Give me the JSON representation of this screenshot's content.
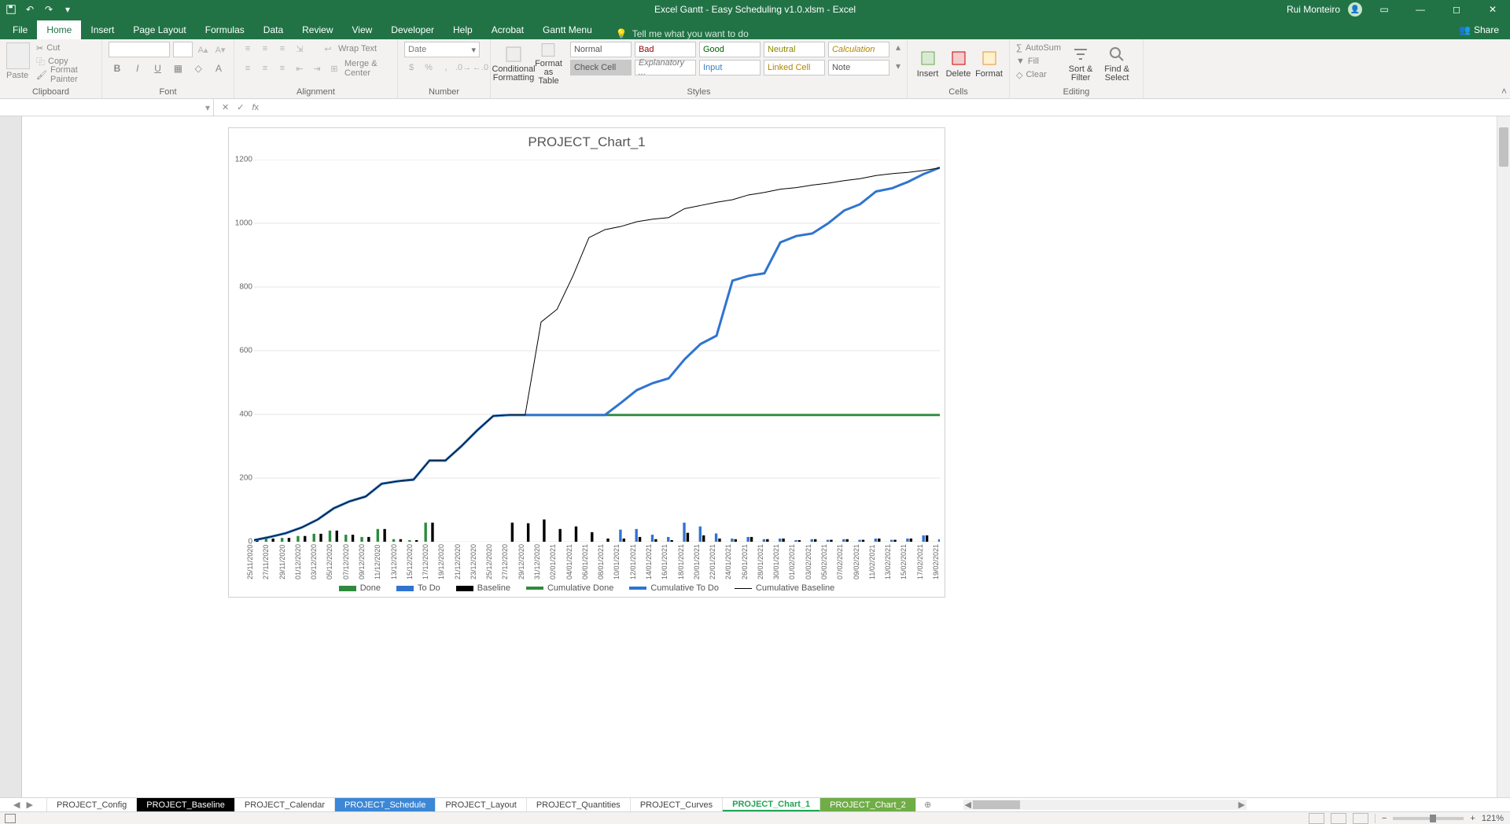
{
  "titlebar": {
    "app_title": "Excel Gantt - Easy Scheduling v1.0.xlsm - Excel",
    "user": "Rui Monteiro"
  },
  "ribbon_tabs": [
    "File",
    "Home",
    "Insert",
    "Page Layout",
    "Formulas",
    "Data",
    "Review",
    "View",
    "Developer",
    "Help",
    "Acrobat",
    "Gantt Menu"
  ],
  "tellme": "Tell me what you want to do",
  "share": "Share",
  "clipboard": {
    "paste": "Paste",
    "cut": "Cut",
    "copy": "Copy",
    "painter": "Format Painter",
    "label": "Clipboard"
  },
  "font": {
    "label": "Font"
  },
  "alignment": {
    "wrap": "Wrap Text",
    "merge": "Merge & Center",
    "label": "Alignment"
  },
  "number": {
    "format": "Date",
    "label": "Number"
  },
  "styles": {
    "cond": "Conditional Formatting",
    "table": "Format as Table",
    "normal": "Normal",
    "bad": "Bad",
    "good": "Good",
    "neutral": "Neutral",
    "calc": "Calculation",
    "check": "Check Cell",
    "explan": "Explanatory ...",
    "input": "Input",
    "linked": "Linked Cell",
    "note": "Note",
    "label": "Styles"
  },
  "cells": {
    "insert": "Insert",
    "delete": "Delete",
    "format": "Format",
    "label": "Cells"
  },
  "editing": {
    "autosum": "AutoSum",
    "fill": "Fill",
    "clear": "Clear",
    "sort": "Sort & Filter",
    "find": "Find & Select",
    "label": "Editing"
  },
  "sheet_tabs": [
    {
      "name": "PROJECT_Config",
      "style": "plain"
    },
    {
      "name": "PROJECT_Baseline",
      "style": "dark"
    },
    {
      "name": "PROJECT_Calendar",
      "style": "plain"
    },
    {
      "name": "PROJECT_Schedule",
      "style": "blue"
    },
    {
      "name": "PROJECT_Layout",
      "style": "plain"
    },
    {
      "name": "PROJECT_Quantities",
      "style": "plain"
    },
    {
      "name": "PROJECT_Curves",
      "style": "plain"
    },
    {
      "name": "PROJECT_Chart_1",
      "style": "active"
    },
    {
      "name": "PROJECT_Chart_2",
      "style": "green"
    }
  ],
  "status": {
    "zoom": "121%"
  },
  "chart_data": {
    "type": "combo",
    "title": "PROJECT_Chart_1",
    "ylim": [
      0,
      1200
    ],
    "yticks": [
      0,
      200,
      400,
      600,
      800,
      1000,
      1200
    ],
    "categories": [
      "25/11/2020",
      "27/11/2020",
      "29/11/2020",
      "01/12/2020",
      "03/12/2020",
      "05/12/2020",
      "07/12/2020",
      "09/12/2020",
      "11/12/2020",
      "13/12/2020",
      "15/12/2020",
      "17/12/2020",
      "19/12/2020",
      "21/12/2020",
      "23/12/2020",
      "25/12/2020",
      "27/12/2020",
      "29/12/2020",
      "31/12/2020",
      "02/01/2021",
      "04/01/2021",
      "06/01/2021",
      "08/01/2021",
      "10/01/2021",
      "12/01/2021",
      "14/01/2021",
      "16/01/2021",
      "18/01/2021",
      "20/01/2021",
      "22/01/2021",
      "24/01/2021",
      "26/01/2021",
      "28/01/2021",
      "30/01/2021",
      "01/02/2021",
      "03/02/2021",
      "05/02/2021",
      "07/02/2021",
      "09/02/2021",
      "11/02/2021",
      "13/02/2021",
      "15/02/2021",
      "17/02/2021",
      "19/02/2021"
    ],
    "series": [
      {
        "name": "Done",
        "type": "bar",
        "color": "#2e8b3d",
        "values": [
          5,
          10,
          12,
          18,
          25,
          35,
          22,
          15,
          40,
          8,
          5,
          60,
          0,
          0,
          0,
          0,
          0,
          0,
          0,
          0,
          0,
          0,
          0,
          0,
          0,
          0,
          0,
          0,
          0,
          0,
          0,
          0,
          0,
          0,
          0,
          0,
          0,
          0,
          0,
          0,
          0,
          0,
          0,
          0
        ]
      },
      {
        "name": "To Do",
        "type": "bar",
        "color": "#2f74d0",
        "values": [
          0,
          0,
          0,
          0,
          0,
          0,
          0,
          0,
          0,
          0,
          0,
          0,
          0,
          0,
          0,
          0,
          0,
          0,
          0,
          0,
          0,
          0,
          0,
          38,
          40,
          22,
          15,
          60,
          48,
          26,
          10,
          15,
          8,
          10,
          5,
          8,
          6,
          8,
          6,
          10,
          6,
          10,
          20,
          8
        ]
      },
      {
        "name": "Baseline",
        "type": "bar",
        "color": "#000",
        "values": [
          5,
          10,
          12,
          18,
          25,
          35,
          22,
          15,
          40,
          8,
          5,
          60,
          0,
          0,
          0,
          0,
          60,
          58,
          70,
          40,
          48,
          30,
          10,
          10,
          15,
          8,
          5,
          28,
          20,
          10,
          8,
          15,
          8,
          10,
          5,
          8,
          6,
          8,
          6,
          10,
          6,
          10,
          20,
          8
        ]
      },
      {
        "name": "Cumulative Done",
        "type": "line",
        "color": "#2e8b3d",
        "width": 3,
        "values": [
          5,
          15,
          27,
          45,
          70,
          105,
          127,
          142,
          182,
          190,
          195,
          255,
          255,
          300,
          350,
          395,
          398,
          398,
          398,
          398,
          398,
          398,
          398,
          398,
          398,
          398,
          398,
          398,
          398,
          398,
          398,
          398,
          398,
          398,
          398,
          398,
          398,
          398,
          398,
          398,
          398,
          398,
          398,
          398
        ]
      },
      {
        "name": "Cumulative To Do",
        "type": "line",
        "color": "#2f74d0",
        "width": 3,
        "values": [
          5,
          15,
          27,
          45,
          70,
          105,
          127,
          142,
          182,
          190,
          195,
          255,
          255,
          300,
          350,
          395,
          398,
          398,
          398,
          398,
          398,
          398,
          398,
          436,
          476,
          498,
          513,
          573,
          621,
          647,
          820,
          835,
          843,
          940,
          960,
          968,
          1000,
          1040,
          1060,
          1100,
          1110,
          1130,
          1155,
          1175
        ]
      },
      {
        "name": "Cumulative Baseline",
        "type": "line",
        "color": "#000",
        "width": 1,
        "values": [
          5,
          15,
          27,
          45,
          70,
          105,
          127,
          142,
          182,
          190,
          195,
          255,
          255,
          300,
          350,
          395,
          398,
          398,
          690,
          730,
          835,
          955,
          980,
          990,
          1005,
          1013,
          1018,
          1046,
          1056,
          1066,
          1074,
          1089,
          1097,
          1107,
          1112,
          1120,
          1126,
          1134,
          1140,
          1150,
          1156,
          1160,
          1166,
          1174
        ]
      }
    ],
    "legend": [
      "Done",
      "To Do",
      "Baseline",
      "Cumulative Done",
      "Cumulative To Do",
      "Cumulative Baseline"
    ]
  }
}
